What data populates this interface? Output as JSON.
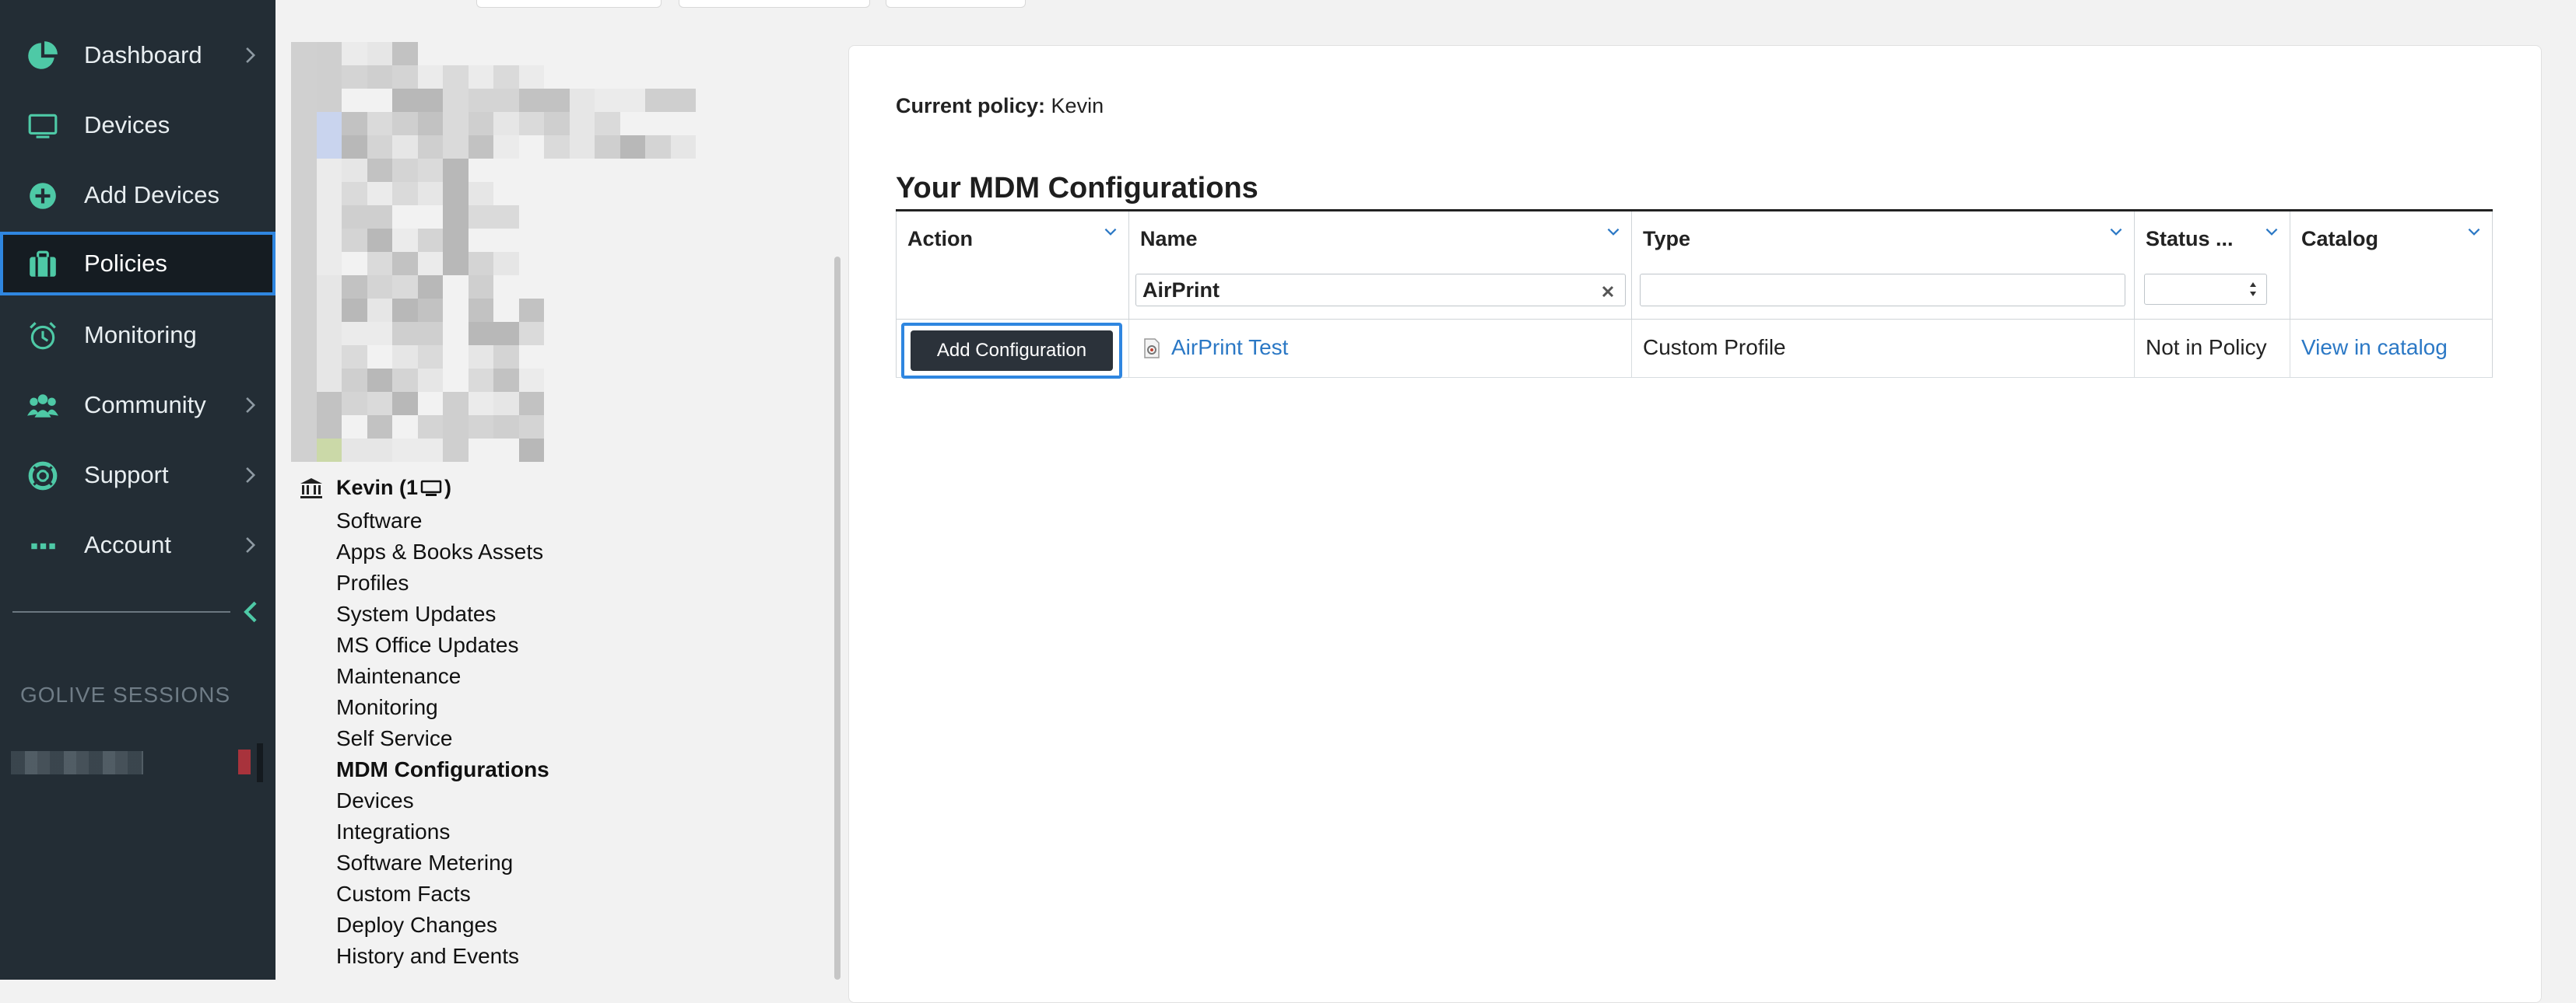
{
  "nav": {
    "items": [
      {
        "label": "Dashboard",
        "icon": "pie-chart-icon",
        "has_chevron": true
      },
      {
        "label": "Devices",
        "icon": "monitor-icon",
        "has_chevron": false
      },
      {
        "label": "Add Devices",
        "icon": "plus-circle-icon",
        "has_chevron": false
      },
      {
        "label": "Policies",
        "icon": "briefcase-icon",
        "has_chevron": false,
        "active": true
      },
      {
        "label": "Monitoring",
        "icon": "alarm-clock-icon",
        "has_chevron": false
      },
      {
        "label": "Community",
        "icon": "users-icon",
        "has_chevron": true
      },
      {
        "label": "Support",
        "icon": "lifebuoy-icon",
        "has_chevron": true
      },
      {
        "label": "Account",
        "icon": "dots-icon",
        "has_chevron": true
      }
    ],
    "sessions_title": "GOLIVE SESSIONS",
    "accent": "#4ec9a6"
  },
  "tree": {
    "root_label": "Kevin (1",
    "items": [
      "Software",
      "Apps & Books Assets",
      "Profiles",
      "System Updates",
      "MS Office Updates",
      "Maintenance",
      "Monitoring",
      "Self Service",
      "MDM Configurations",
      "Devices",
      "Integrations",
      "Software Metering",
      "Custom Facts",
      "Deploy Changes",
      "History and Events"
    ],
    "current": "MDM Configurations"
  },
  "main": {
    "current_policy_label": "Current policy:",
    "current_policy_value": "Kevin",
    "section_title": "Your MDM Configurations",
    "columns": {
      "action": "Action",
      "name": "Name",
      "type": "Type",
      "status": "Status ...",
      "catalog": "Catalog"
    },
    "filters": {
      "name_value": "AirPrint",
      "type_value": ""
    },
    "rows": [
      {
        "action_label": "Add Configuration",
        "name": "AirPrint Test",
        "type": "Custom Profile",
        "status": "Not in Policy",
        "catalog": "View in catalog"
      }
    ]
  },
  "colors": {
    "nav_bg": "#232d35",
    "active_outline": "#2f86e0",
    "link": "#2b78c5",
    "button_bg": "#2b323a"
  }
}
